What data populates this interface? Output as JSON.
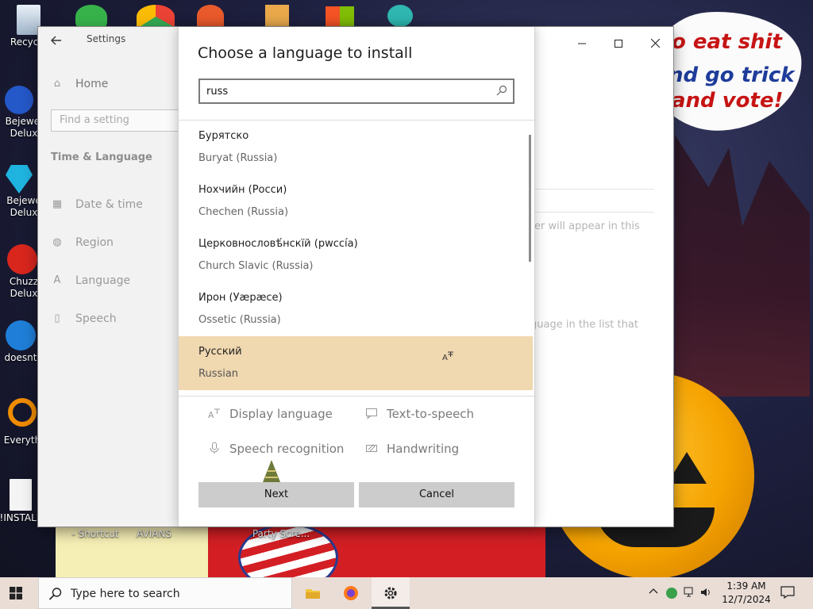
{
  "desktop": {
    "icons": [
      {
        "name": "recycle-bin",
        "label": "Recycle"
      },
      {
        "name": "bejeweled-1",
        "label": "Bejewel Delux"
      },
      {
        "name": "bejeweled-2",
        "label": "Bejewe Delux"
      },
      {
        "name": "chuzzle",
        "label": "Chuzz Delux"
      },
      {
        "name": "doesnt",
        "label": "doesnt"
      },
      {
        "name": "everything",
        "label": "Everyth"
      },
      {
        "name": "install",
        "label": "!INSTALL"
      }
    ],
    "bottom_labels": [
      "- Shortcut",
      "AVIANS",
      "Party Scre..."
    ],
    "bubble_lines": [
      "o eat shit",
      "nd go trick",
      "and vote!"
    ]
  },
  "settings": {
    "window_title": "Settings",
    "home_label": "Home",
    "find_placeholder": "Find a setting",
    "section_title": "Time & Language",
    "nav": [
      "Date & time",
      "Region",
      "Language",
      "Speech"
    ],
    "faded_text_1": "rer will appear in this",
    "faded_text_2": "guage in the list that"
  },
  "dialog": {
    "title": "Choose a language to install",
    "search_value": "russ",
    "languages": [
      {
        "native": "Бурятско",
        "english": "Buryat (Russia)",
        "selected": false
      },
      {
        "native": "Нохчийн (Росси)",
        "english": "Chechen (Russia)",
        "selected": false
      },
      {
        "native": "Церковнословѣ́нскїй (рwссі́а)",
        "english": "Church Slavic (Russia)",
        "selected": false
      },
      {
        "native": "Ирон (Уæрæсе)",
        "english": "Ossetic (Russia)",
        "selected": false
      },
      {
        "native": "Русский",
        "english": "Russian",
        "selected": true
      }
    ],
    "features": [
      {
        "icon": "display-language-icon",
        "label": "Display language"
      },
      {
        "icon": "text-to-speech-icon",
        "label": "Text-to-speech"
      },
      {
        "icon": "speech-recognition-icon",
        "label": "Speech recognition"
      },
      {
        "icon": "handwriting-icon",
        "label": "Handwriting"
      }
    ],
    "next_label": "Next",
    "cancel_label": "Cancel"
  },
  "taskbar": {
    "search_placeholder": "Type here to search",
    "time": "1:39 AM",
    "date": "12/7/2024"
  },
  "colors": {
    "selected_row": "#f0d8b0",
    "button_bg": "#cccccc",
    "taskbar": "#e9ddd6"
  }
}
